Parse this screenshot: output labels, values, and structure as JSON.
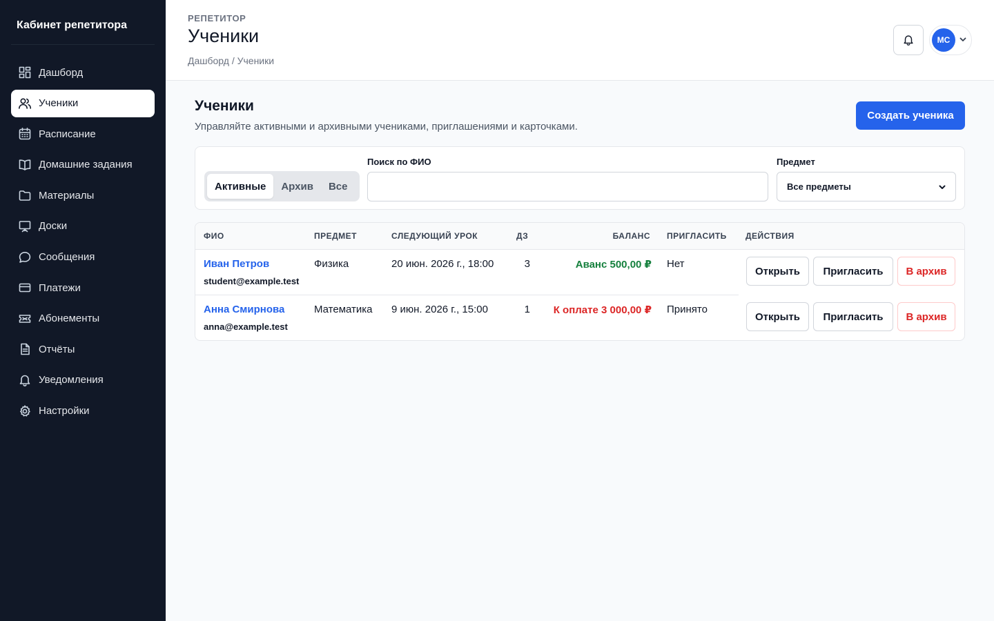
{
  "sidebar": {
    "brand": "Кабинет репетитора",
    "items": [
      {
        "label": "Дашборд",
        "icon": "dashboard-icon"
      },
      {
        "label": "Ученики",
        "icon": "users-icon"
      },
      {
        "label": "Расписание",
        "icon": "calendar-icon"
      },
      {
        "label": "Домашние задания",
        "icon": "book-icon"
      },
      {
        "label": "Материалы",
        "icon": "folder-icon"
      },
      {
        "label": "Доски",
        "icon": "whiteboard-icon"
      },
      {
        "label": "Сообщения",
        "icon": "chat-icon"
      },
      {
        "label": "Платежи",
        "icon": "card-icon"
      },
      {
        "label": "Абонементы",
        "icon": "ticket-icon"
      },
      {
        "label": "Отчёты",
        "icon": "report-icon"
      },
      {
        "label": "Уведомления",
        "icon": "bell-icon"
      },
      {
        "label": "Настройки",
        "icon": "gear-icon"
      }
    ],
    "active": "Ученики"
  },
  "header": {
    "eyebrow": "РЕПЕТИТОР",
    "title": "Ученики",
    "breadcrumb": "Дашборд / Ученики",
    "avatar_initials": "МС"
  },
  "main": {
    "title": "Ученики",
    "subtitle": "Управляйте активными и архивными учениками, приглашениями и карточками.",
    "create_label": "Создать ученика"
  },
  "filters": {
    "tabs": [
      "Активные",
      "Архив",
      "Все"
    ],
    "active_tab": "Активные",
    "search_label": "Поиск по ФИО",
    "search_value": "",
    "subject_label": "Предмет",
    "subject_value": "Все предметы"
  },
  "table": {
    "columns": [
      "ФИО",
      "ПРЕДМЕТ",
      "СЛЕДУЮЩИЙ УРОК",
      "ДЗ",
      "БАЛАНС",
      "ПРИГЛАСИТЬ",
      "ДЕЙСТВИЯ"
    ],
    "rows": [
      {
        "name": "Иван Петров",
        "email": "student@example.test",
        "subject": "Физика",
        "next_lesson": "20 июн. 2026 г., 18:00",
        "homework": "3",
        "balance": "Аванс 500,00 ₽",
        "balance_status": "positive",
        "invite": "Нет"
      },
      {
        "name": "Анна Смирнова",
        "email": "anna@example.test",
        "subject": "Математика",
        "next_lesson": "9 июн. 2026 г., 15:00",
        "homework": "1",
        "balance": "К оплате 3 000,00 ₽",
        "balance_status": "negative",
        "invite": "Принято"
      }
    ],
    "actions": {
      "open": "Открыть",
      "invite": "Пригласить",
      "archive": "В архив"
    }
  },
  "colors": {
    "sidebar_bg": "#111827",
    "accent": "#2563eb",
    "positive": "#15803d",
    "negative": "#dc2626"
  }
}
